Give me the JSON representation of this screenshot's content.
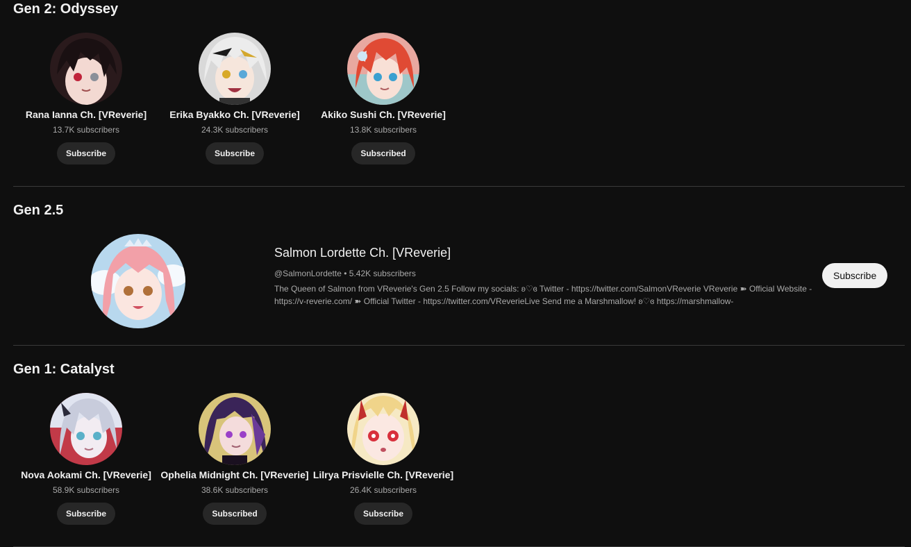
{
  "sections": {
    "gen2": {
      "title": "Gen 2: Odyssey",
      "channels": [
        {
          "name": "Rana Ianna Ch. [VReverie]",
          "subscribers": "13.7K subscribers",
          "button": "Subscribe"
        },
        {
          "name": "Erika Byakko Ch. [VReverie]",
          "subscribers": "24.3K subscribers",
          "button": "Subscribe"
        },
        {
          "name": "Akiko Sushi Ch. [VReverie]",
          "subscribers": "13.8K subscribers",
          "button": "Subscribed"
        }
      ]
    },
    "gen25": {
      "title": "Gen 2.5",
      "featured": {
        "name": "Salmon Lordette Ch. [VReverie]",
        "handle": "@SalmonLordette",
        "separator": "•",
        "subscribers": "5.42K subscribers",
        "description": "The Queen of Salmon from VReverie's Gen 2.5 Follow my socials: ʚ♡ɞ Twitter - https://twitter.com/SalmonVReverie VReverie ➽ Official Website - https://v-reverie.com/ ➽ Official Twitter - https://twitter.com/VReverieLive Send me a Marshmallow! ʚ♡ɞ https://marshmallow-",
        "button": "Subscribe"
      }
    },
    "gen1": {
      "title": "Gen 1: Catalyst",
      "channels": [
        {
          "name": "Nova Aokami Ch. [VReverie]",
          "subscribers": "58.9K subscribers",
          "button": "Subscribe"
        },
        {
          "name": "Ophelia Midnight Ch. [VReverie]",
          "subscribers": "38.6K subscribers",
          "button": "Subscribed"
        },
        {
          "name": "Lilrya Prisvielle Ch. [VReverie]",
          "subscribers": "26.4K subscribers",
          "button": "Subscribe"
        }
      ]
    }
  },
  "colors": {
    "background": "#0f0f0f",
    "text": "#f1f1f1",
    "secondary_text": "#aaaaaa",
    "button_dark": "#272727",
    "button_light": "#f1f1f1"
  }
}
